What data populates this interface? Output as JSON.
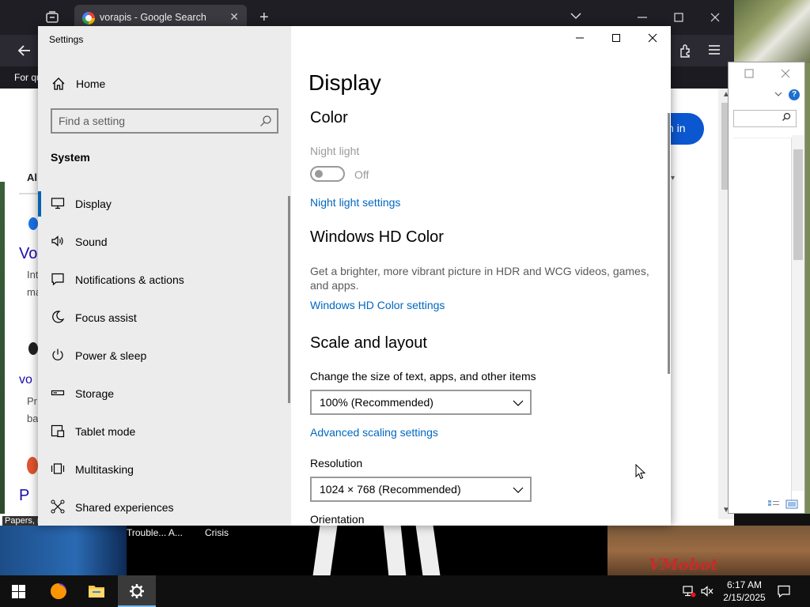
{
  "browser": {
    "tab_title": "vorapis - Google Search",
    "notice": "For qu",
    "signin_label": "n in",
    "frag_all": "Al",
    "frag_v1": "Vo",
    "frag_int": "Int",
    "frag_ma": "ma",
    "frag_v2": "vo",
    "frag_pr": "Pr",
    "frag_ba": "ba",
    "frag_p": "P",
    "papers": "Papers, r"
  },
  "desktop": {
    "label_trouble": "Trouble... A...",
    "label_crisis": "Crisis",
    "watermark": "VMobot"
  },
  "settings": {
    "window_title": "Settings",
    "nav": {
      "home": "Home",
      "search_placeholder": "Find a setting",
      "section": "System",
      "items": [
        {
          "label": "Display",
          "icon": "monitor-icon"
        },
        {
          "label": "Sound",
          "icon": "speaker-icon"
        },
        {
          "label": "Notifications & actions",
          "icon": "notifications-icon"
        },
        {
          "label": "Focus assist",
          "icon": "moon-icon"
        },
        {
          "label": "Power & sleep",
          "icon": "power-icon"
        },
        {
          "label": "Storage",
          "icon": "storage-icon"
        },
        {
          "label": "Tablet mode",
          "icon": "tablet-icon"
        },
        {
          "label": "Multitasking",
          "icon": "multitasking-icon"
        },
        {
          "label": "Shared experiences",
          "icon": "shared-experiences-icon"
        }
      ]
    },
    "content": {
      "page_title": "Display",
      "color_heading": "Color",
      "night_light_label": "Night light",
      "night_light_state": "Off",
      "night_light_on": false,
      "night_light_link": "Night light settings",
      "hd_heading": "Windows HD Color",
      "hd_desc": "Get a brighter, more vibrant picture in HDR and WCG videos, games, and apps.",
      "hd_link": "Windows HD Color settings",
      "scale_heading": "Scale and layout",
      "scale_label": "Change the size of text, apps, and other items",
      "scale_value": "100% (Recommended)",
      "advanced_link": "Advanced scaling settings",
      "resolution_label": "Resolution",
      "resolution_value": "1024 × 768 (Recommended)",
      "orientation_label": "Orientation"
    }
  },
  "taskbar": {
    "time": "6:17 AM",
    "date": "2/15/2025"
  },
  "colors": {
    "accent": "#0063b1",
    "link": "#0067c0",
    "nav_bg": "#ececec"
  }
}
